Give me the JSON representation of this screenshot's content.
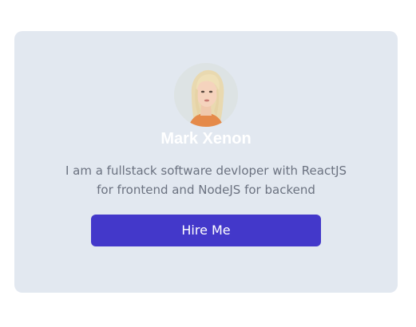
{
  "profile": {
    "name": "Mark Xenon",
    "bio": "I am a fullstack software devloper with ReactJS for frontend and NodeJS for backend",
    "avatar_icon": "profile-photo",
    "hire_label": "Hire Me"
  },
  "colors": {
    "card_background": "#e2e8f0",
    "button_background": "#4338ca",
    "name_text": "#ffffff",
    "bio_text": "#6b7280"
  }
}
